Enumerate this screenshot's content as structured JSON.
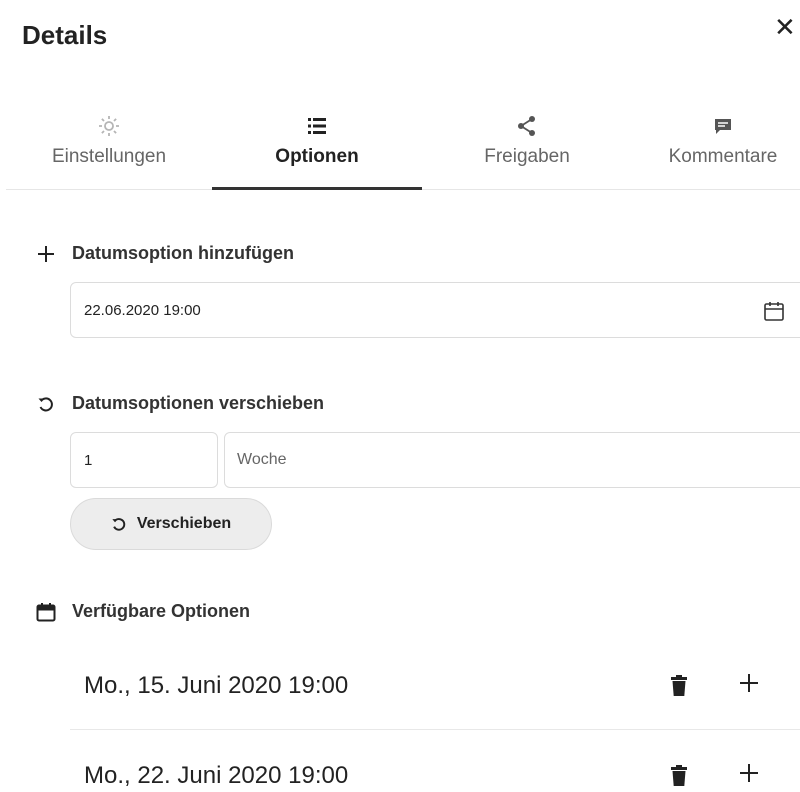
{
  "header": {
    "title": "Details"
  },
  "tabs": [
    {
      "label": "Einstellungen",
      "icon": "gear-icon",
      "active": false
    },
    {
      "label": "Optionen",
      "icon": "list-icon",
      "active": true
    },
    {
      "label": "Freigaben",
      "icon": "share-icon",
      "active": false
    },
    {
      "label": "Kommentare",
      "icon": "comment-icon",
      "active": false
    }
  ],
  "add_date": {
    "heading": "Datumsoption hinzufügen",
    "value": "22.06.2020 19:00"
  },
  "shift_dates": {
    "heading": "Datumsoptionen verschieben",
    "amount": "1",
    "unit": "Woche",
    "button_label": "Verschieben"
  },
  "available": {
    "heading": "Verfügbare Optionen",
    "options": [
      {
        "label": "Mo., 15. Juni 2020 19:00"
      },
      {
        "label": "Mo., 22. Juni 2020 19:00"
      }
    ]
  },
  "colors": {
    "text": "#222222",
    "muted": "#666666",
    "border": "#dcdcdc",
    "button_bg": "#ededed"
  }
}
